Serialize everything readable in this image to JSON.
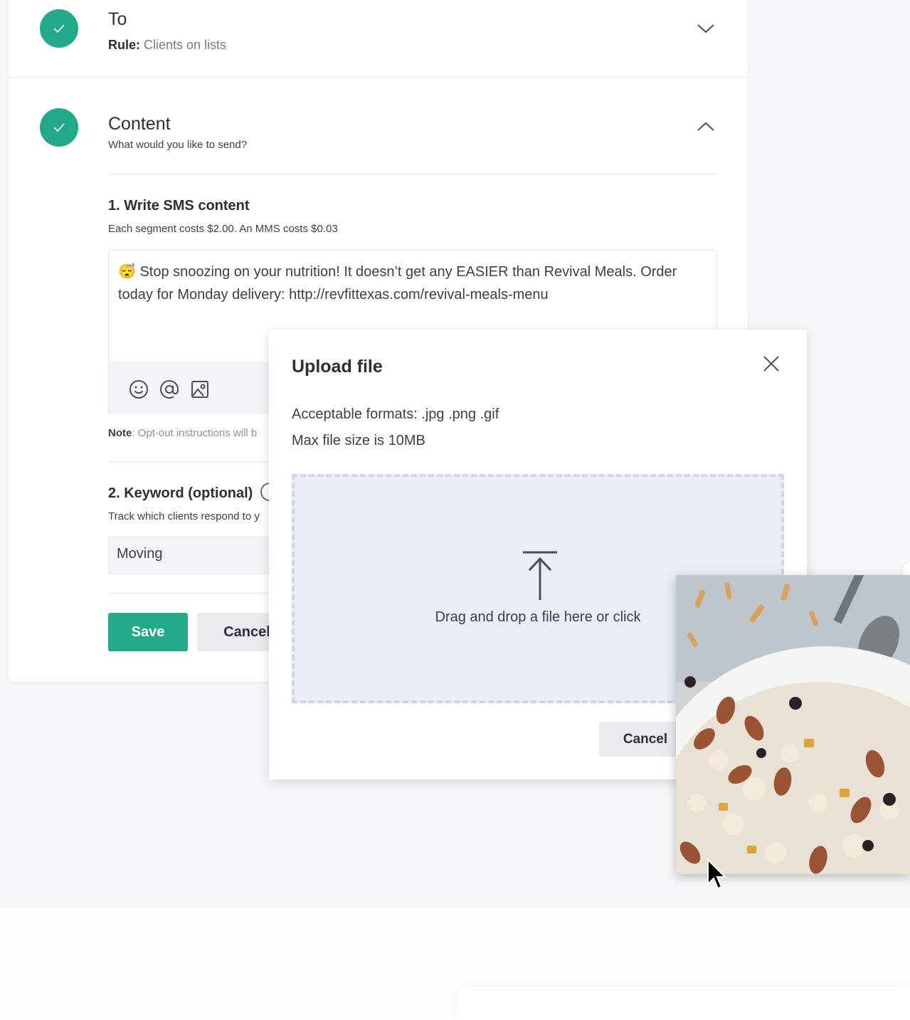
{
  "to_step": {
    "title": "To",
    "rule_label": "Rule:",
    "rule_value": "Clients on lists"
  },
  "content_step": {
    "title": "Content",
    "subtitle": "What would you like to send?"
  },
  "sms": {
    "heading": "1. Write SMS content",
    "cost_note": "Each segment costs $2.00. An MMS costs $0.03",
    "emoji": "😴",
    "message": "Stop snoozing on your nutrition! It doesn’t get any EASIER than Revival Meals. Order today for Monday delivery: http://revfittexas.com/revival-meals-menu",
    "toolbar": [
      "emoji-icon",
      "mention-icon",
      "image-icon"
    ],
    "note_label": "Note",
    "note_text": ": Opt-out instructions will b"
  },
  "keyword": {
    "heading": "2. Keyword (optional)",
    "description": "Track which clients respond to y",
    "value": "Moving"
  },
  "actions": {
    "save_label": "Save",
    "cancel_label": "Cancel"
  },
  "upload_modal": {
    "title": "Upload file",
    "formats": "Acceptable formats: .jpg .png .gif",
    "max_size": "Max file size is 10MB",
    "drop_text": "Drag and drop a file here or click",
    "cancel_label": "Cancel"
  },
  "colors": {
    "accent": "#22a98a",
    "dropzone": "#e9edf6",
    "background": "#f5f7fa"
  }
}
